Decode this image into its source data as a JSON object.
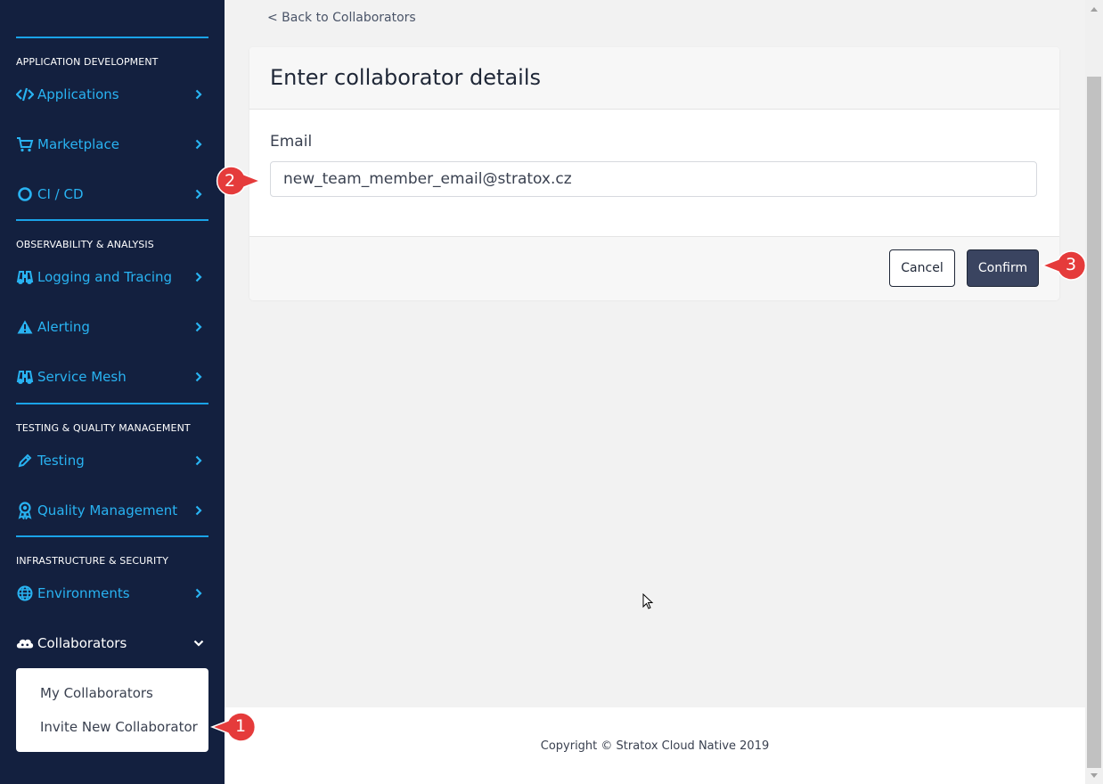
{
  "sidebar": {
    "sections": [
      {
        "title": "APPLICATION DEVELOPMENT"
      },
      {
        "title": "OBSERVABILITY & ANALYSIS"
      },
      {
        "title": "TESTING & QUALITY MANAGEMENT"
      },
      {
        "title": "INFRASTRUCTURE & SECURITY"
      }
    ],
    "items": [
      {
        "label": "Applications",
        "icon": "code-icon"
      },
      {
        "label": "Marketplace",
        "icon": "cart-icon"
      },
      {
        "label": "CI / CD",
        "icon": "circle-icon"
      },
      {
        "label": "Logging and Tracing",
        "icon": "binoculars-icon"
      },
      {
        "label": "Alerting",
        "icon": "warning-icon"
      },
      {
        "label": "Service Mesh",
        "icon": "binoculars-icon"
      },
      {
        "label": "Testing",
        "icon": "pencil-icon"
      },
      {
        "label": "Quality Management",
        "icon": "award-icon"
      },
      {
        "label": "Environments",
        "icon": "globe-icon"
      },
      {
        "label": "Collaborators",
        "icon": "users-cloud-icon"
      }
    ],
    "submenu": [
      "My Collaborators",
      "Invite New Collaborator"
    ]
  },
  "main": {
    "back_link": "< Back to Collaborators",
    "card_title": "Enter collaborator details",
    "email_label": "Email",
    "email_value": "new_team_member_email@stratox.cz",
    "cancel_label": "Cancel",
    "confirm_label": "Confirm"
  },
  "footer": {
    "text": "Copyright © Stratox Cloud Native 2019"
  },
  "callouts": [
    "1",
    "2",
    "3"
  ],
  "colors": {
    "sidebar_bg": "#13203f",
    "accent": "#29b3f2",
    "callout": "#e53b3b",
    "confirm_bg": "#3a4460"
  }
}
